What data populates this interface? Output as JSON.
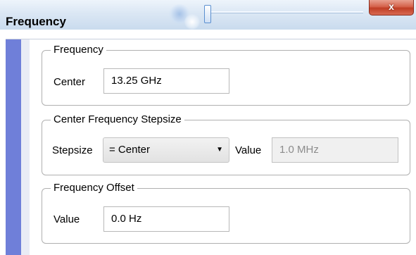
{
  "window": {
    "title": "Frequency",
    "close_glyph": "x",
    "icons": {
      "close": "close-icon",
      "dropdown": "chevron-down-icon"
    }
  },
  "groups": {
    "frequency": {
      "legend": "Frequency",
      "center_label": "Center",
      "center_value": "13.25 GHz"
    },
    "stepsize": {
      "legend": "Center Frequency Stepsize",
      "stepsize_label": "Stepsize",
      "stepsize_selected": "= Center",
      "value_label": "Value",
      "value_value": "1.0 MHz"
    },
    "offset": {
      "legend": "Frequency Offset",
      "value_label": "Value",
      "value_value": "0.0 Hz"
    }
  },
  "colors": {
    "sidebar_accent": "#6f7fd9",
    "close_button": "#c8442a",
    "disabled_text": "#8c8c8c"
  }
}
